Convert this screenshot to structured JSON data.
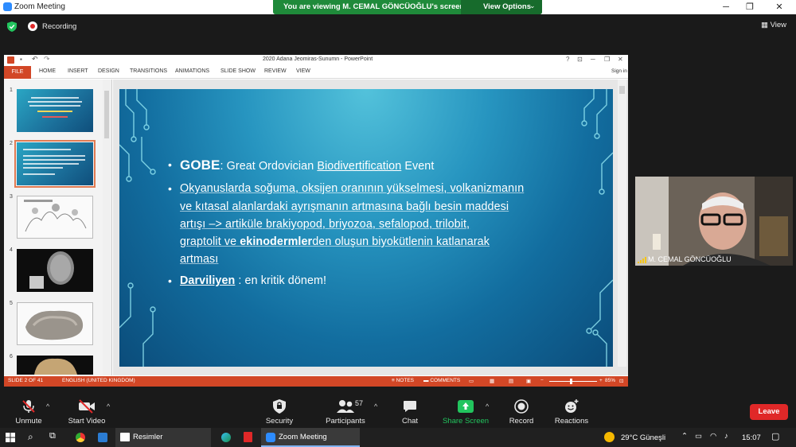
{
  "window": {
    "title": "Zoom Meeting",
    "banner_text": "You are viewing M. CEMAL GÖNCÜOĞLU's screen",
    "view_options": "View Options"
  },
  "zoom_top": {
    "recording": "Recording",
    "view": "View"
  },
  "powerpoint": {
    "title": "2020 Adana Jeomiras-Sunumn - PowerPoint",
    "file_tab": "FILE",
    "tabs": [
      "HOME",
      "INSERT",
      "DESIGN",
      "TRANSITIONS",
      "ANIMATIONS",
      "SLIDE SHOW",
      "REVIEW",
      "VIEW"
    ],
    "sign_in": "Sign in",
    "thumbnails": [
      "1",
      "2",
      "3",
      "4",
      "5",
      "6"
    ],
    "status": {
      "slide": "SLIDE 2 OF 41",
      "language": "ENGLISH (UNITED KINGDOM)",
      "notes": "NOTES",
      "comments": "COMMENTS",
      "zoom": "85%"
    }
  },
  "slide": {
    "b1_head": "GOBE",
    "b1_rest": ": Great Ordovician ",
    "b1_link": "Biodivertification",
    "b1_tail": " Event",
    "b2_l1": "Okyanuslarda soğuma, oksijen oranının yükselmesi, volkanizmanın",
    "b2_l2": "ve kıtasal alanlardaki ayrışmanın artmasına bağlı besin maddesi",
    "b2_l3": "artışı –> artiküle brakiyopod, briyozoa, sefalopod, trilobit,",
    "b2_l4a": "graptolit ve ",
    "b2_l4b": "ekinodermler",
    "b2_l4c": "den oluşun biyokütlenin katlanarak",
    "b2_l5": "artması",
    "b3_head": "Darviliyen",
    "b3_rest": " : en kritik dönem!"
  },
  "video": {
    "name": "M. CEMAL GÖNCÜOĞLU"
  },
  "toolbar": {
    "unmute": "Unmute",
    "start_video": "Start Video",
    "security": "Security",
    "participants": "Participants",
    "participant_count": "57",
    "chat": "Chat",
    "share_screen": "Share Screen",
    "record": "Record",
    "reactions": "Reactions",
    "leave": "Leave"
  },
  "taskbar": {
    "resimler": "Resimler",
    "zoom_meeting": "Zoom Meeting",
    "weather": "29°C Güneşli",
    "time": "15:07"
  },
  "colors": {
    "zoom_bg": "#1a1a1a",
    "banner_green": "#1f8a3a",
    "ppt_accent": "#d24726",
    "leave_red": "#e02828",
    "share_green": "#22c55e"
  }
}
